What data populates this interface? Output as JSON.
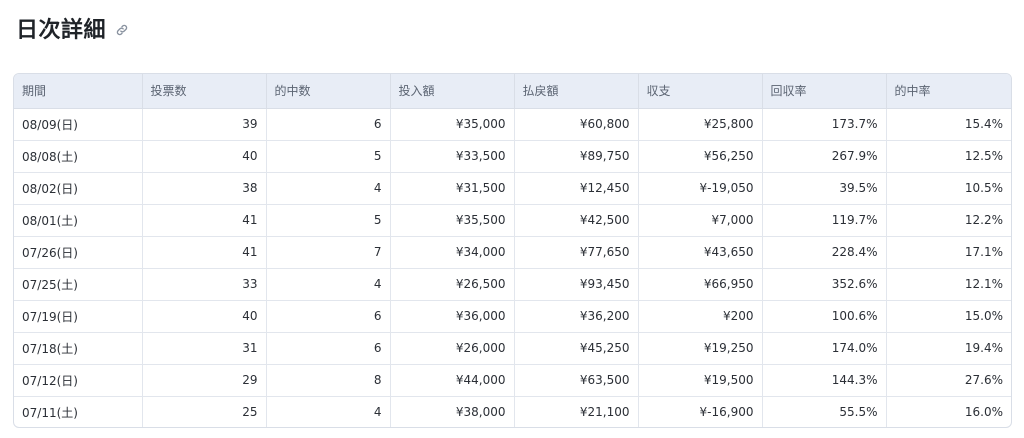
{
  "section": {
    "title": "日次詳細",
    "anchor_icon": "link-icon"
  },
  "table": {
    "columns": [
      "期間",
      "投票数",
      "的中数",
      "投入額",
      "払戻額",
      "収支",
      "回収率",
      "的中率"
    ],
    "rows": [
      [
        "08/09(日)",
        "39",
        "6",
        "¥35,000",
        "¥60,800",
        "¥25,800",
        "173.7%",
        "15.4%"
      ],
      [
        "08/08(土)",
        "40",
        "5",
        "¥33,500",
        "¥89,750",
        "¥56,250",
        "267.9%",
        "12.5%"
      ],
      [
        "08/02(日)",
        "38",
        "4",
        "¥31,500",
        "¥12,450",
        "¥-19,050",
        "39.5%",
        "10.5%"
      ],
      [
        "08/01(土)",
        "41",
        "5",
        "¥35,500",
        "¥42,500",
        "¥7,000",
        "119.7%",
        "12.2%"
      ],
      [
        "07/26(日)",
        "41",
        "7",
        "¥34,000",
        "¥77,650",
        "¥43,650",
        "228.4%",
        "17.1%"
      ],
      [
        "07/25(土)",
        "33",
        "4",
        "¥26,500",
        "¥93,450",
        "¥66,950",
        "352.6%",
        "12.1%"
      ],
      [
        "07/19(日)",
        "40",
        "6",
        "¥36,000",
        "¥36,200",
        "¥200",
        "100.6%",
        "15.0%"
      ],
      [
        "07/18(土)",
        "31",
        "6",
        "¥26,000",
        "¥45,250",
        "¥19,250",
        "174.0%",
        "19.4%"
      ],
      [
        "07/12(日)",
        "29",
        "8",
        "¥44,000",
        "¥63,500",
        "¥19,500",
        "144.3%",
        "27.6%"
      ],
      [
        "07/11(土)",
        "25",
        "4",
        "¥38,000",
        "¥21,100",
        "¥-16,900",
        "55.5%",
        "16.0%"
      ]
    ]
  },
  "colors": {
    "header_bg": "#e8edf6",
    "border": "#d9dee7",
    "text": "#2b2f36",
    "header_text": "#5b6472"
  }
}
